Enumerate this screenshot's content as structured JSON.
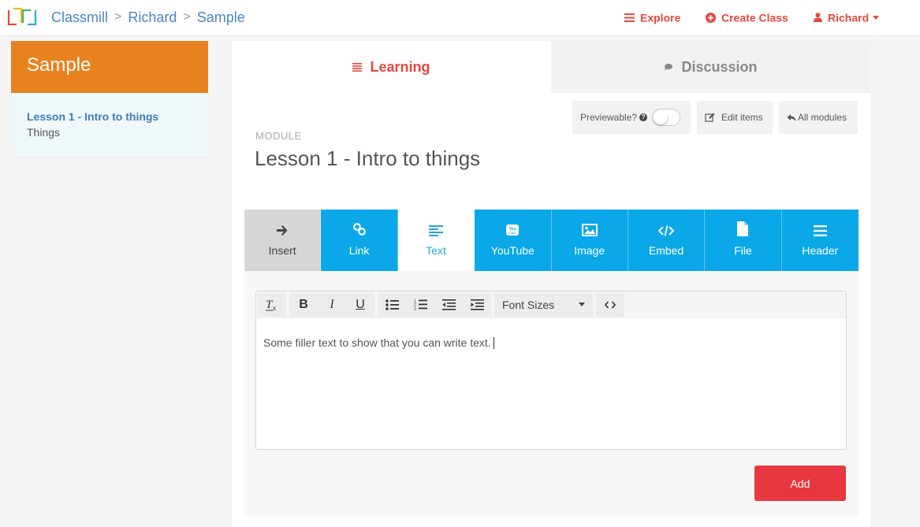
{
  "colors": {
    "accent": "#e8473c",
    "brand_link": "#4a86c5",
    "sidebar_header": "#e8821f",
    "type_tab": "#0aa8e8",
    "add_button": "#e8373f"
  },
  "breadcrumb": {
    "app": "Classmill",
    "user": "Richard",
    "class": "Sample"
  },
  "topnav": {
    "explore": "Explore",
    "create_class": "Create Class",
    "user": "Richard"
  },
  "sidebar": {
    "title": "Sample",
    "items": [
      {
        "title": "Lesson 1 - Intro to things",
        "subtitle": "Things"
      }
    ]
  },
  "tabs": {
    "learning": "Learning",
    "discussion": "Discussion"
  },
  "actions": {
    "previewable": "Previewable?",
    "previewable_on": false,
    "edit_items": "Edit items",
    "all_modules": "All modules"
  },
  "module": {
    "label": "MODULE",
    "title": "Lesson 1 - Intro to things"
  },
  "insert_types": [
    {
      "label": "Insert",
      "icon": "arrow-right-icon"
    },
    {
      "label": "Link",
      "icon": "link-icon"
    },
    {
      "label": "Text",
      "icon": "align-left-icon"
    },
    {
      "label": "YouTube",
      "icon": "youtube-icon"
    },
    {
      "label": "Image",
      "icon": "image-icon"
    },
    {
      "label": "Embed",
      "icon": "code-icon"
    },
    {
      "label": "File",
      "icon": "file-icon"
    },
    {
      "label": "Header",
      "icon": "header-icon"
    }
  ],
  "editor": {
    "font_sizes": "Font Sizes",
    "content": "Some filler text to show that you can write text."
  },
  "add_label": "Add"
}
